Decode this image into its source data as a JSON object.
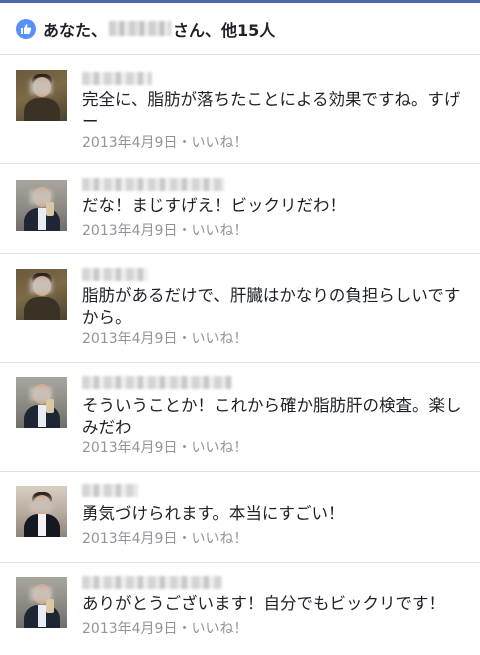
{
  "likes": {
    "prefix": "あなた、",
    "suffix": "さん、他15人",
    "icon": "thumbs-up-icon",
    "badge_color": "#5890ff"
  },
  "comments": [
    {
      "text": "完全に、脂肪が落ちたことによる効果ですね。すげー",
      "meta": "2013年4月9日・いいね！"
    },
    {
      "text": "だな！まじすげえ！ビックリだわ！",
      "meta": "2013年4月9日・いいね！"
    },
    {
      "text": "脂肪があるだけで、肝臓はかなりの負担らしいですから。",
      "meta": "2013年4月9日・いいね！"
    },
    {
      "text": "そういうことか！これから確か脂肪肝の検査。楽しみだわ",
      "meta": "2013年4月9日・いいね！"
    },
    {
      "text": "勇気づけられます。本当にすごい！",
      "meta": "2013年4月9日・いいね！"
    },
    {
      "text": "ありがとうございます！自分でもビックリです！",
      "meta": "2013年4月9日・いいね！"
    }
  ]
}
